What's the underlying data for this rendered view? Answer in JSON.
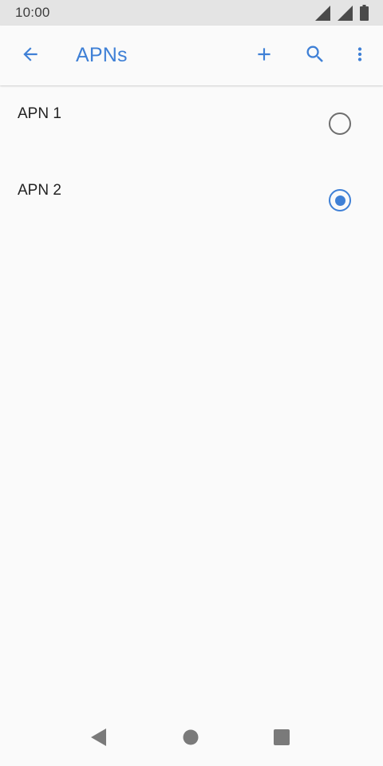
{
  "status_bar": {
    "time": "10:00"
  },
  "app_bar": {
    "title": "APNs",
    "icons": [
      "arrow-back-icon",
      "plus-icon",
      "search-icon",
      "more-vert-icon"
    ]
  },
  "apns": [
    {
      "label": "APN 1",
      "selected": false
    },
    {
      "label": "APN 2",
      "selected": true
    }
  ],
  "nav_bar": {
    "icons": [
      "nav-back-icon",
      "nav-home-icon",
      "nav-recents-icon"
    ]
  },
  "colors": {
    "accent": "#3f80d6",
    "status_bar_bg": "#e4e4e4",
    "background": "#fafafa",
    "text": "#222222",
    "radio_unchecked": "#6e6e6e",
    "nav_icons": "#7a7a7a"
  }
}
